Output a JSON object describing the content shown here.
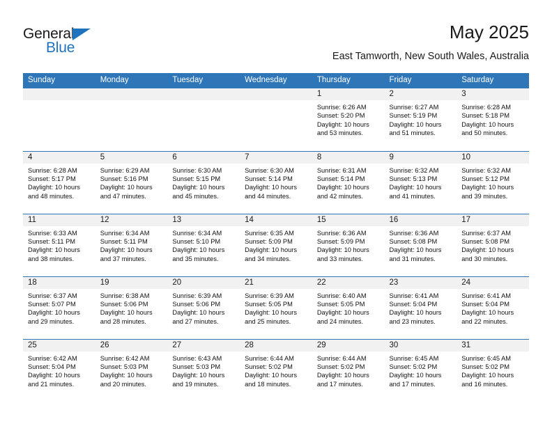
{
  "brand": {
    "name_part1": "General",
    "name_part2": "Blue",
    "triangle_color": "#1f72bd"
  },
  "header": {
    "title": "May 2025",
    "subtitle": "East Tamworth, New South Wales, Australia"
  },
  "theme": {
    "header_bar": "#2f76b8",
    "daynum_strip": "#f1f1f1",
    "row_divider": "#2f76b8",
    "text": "#1a1a1a"
  },
  "weekdays": [
    "Sunday",
    "Monday",
    "Tuesday",
    "Wednesday",
    "Thursday",
    "Friday",
    "Saturday"
  ],
  "weeks": [
    [
      {
        "day": ""
      },
      {
        "day": ""
      },
      {
        "day": ""
      },
      {
        "day": ""
      },
      {
        "day": "1",
        "sunrise": "Sunrise: 6:26 AM",
        "sunset": "Sunset: 5:20 PM",
        "daylight_l1": "Daylight: 10 hours",
        "daylight_l2": "and 53 minutes."
      },
      {
        "day": "2",
        "sunrise": "Sunrise: 6:27 AM",
        "sunset": "Sunset: 5:19 PM",
        "daylight_l1": "Daylight: 10 hours",
        "daylight_l2": "and 51 minutes."
      },
      {
        "day": "3",
        "sunrise": "Sunrise: 6:28 AM",
        "sunset": "Sunset: 5:18 PM",
        "daylight_l1": "Daylight: 10 hours",
        "daylight_l2": "and 50 minutes."
      }
    ],
    [
      {
        "day": "4",
        "sunrise": "Sunrise: 6:28 AM",
        "sunset": "Sunset: 5:17 PM",
        "daylight_l1": "Daylight: 10 hours",
        "daylight_l2": "and 48 minutes."
      },
      {
        "day": "5",
        "sunrise": "Sunrise: 6:29 AM",
        "sunset": "Sunset: 5:16 PM",
        "daylight_l1": "Daylight: 10 hours",
        "daylight_l2": "and 47 minutes."
      },
      {
        "day": "6",
        "sunrise": "Sunrise: 6:30 AM",
        "sunset": "Sunset: 5:15 PM",
        "daylight_l1": "Daylight: 10 hours",
        "daylight_l2": "and 45 minutes."
      },
      {
        "day": "7",
        "sunrise": "Sunrise: 6:30 AM",
        "sunset": "Sunset: 5:14 PM",
        "daylight_l1": "Daylight: 10 hours",
        "daylight_l2": "and 44 minutes."
      },
      {
        "day": "8",
        "sunrise": "Sunrise: 6:31 AM",
        "sunset": "Sunset: 5:14 PM",
        "daylight_l1": "Daylight: 10 hours",
        "daylight_l2": "and 42 minutes."
      },
      {
        "day": "9",
        "sunrise": "Sunrise: 6:32 AM",
        "sunset": "Sunset: 5:13 PM",
        "daylight_l1": "Daylight: 10 hours",
        "daylight_l2": "and 41 minutes."
      },
      {
        "day": "10",
        "sunrise": "Sunrise: 6:32 AM",
        "sunset": "Sunset: 5:12 PM",
        "daylight_l1": "Daylight: 10 hours",
        "daylight_l2": "and 39 minutes."
      }
    ],
    [
      {
        "day": "11",
        "sunrise": "Sunrise: 6:33 AM",
        "sunset": "Sunset: 5:11 PM",
        "daylight_l1": "Daylight: 10 hours",
        "daylight_l2": "and 38 minutes."
      },
      {
        "day": "12",
        "sunrise": "Sunrise: 6:34 AM",
        "sunset": "Sunset: 5:11 PM",
        "daylight_l1": "Daylight: 10 hours",
        "daylight_l2": "and 37 minutes."
      },
      {
        "day": "13",
        "sunrise": "Sunrise: 6:34 AM",
        "sunset": "Sunset: 5:10 PM",
        "daylight_l1": "Daylight: 10 hours",
        "daylight_l2": "and 35 minutes."
      },
      {
        "day": "14",
        "sunrise": "Sunrise: 6:35 AM",
        "sunset": "Sunset: 5:09 PM",
        "daylight_l1": "Daylight: 10 hours",
        "daylight_l2": "and 34 minutes."
      },
      {
        "day": "15",
        "sunrise": "Sunrise: 6:36 AM",
        "sunset": "Sunset: 5:09 PM",
        "daylight_l1": "Daylight: 10 hours",
        "daylight_l2": "and 33 minutes."
      },
      {
        "day": "16",
        "sunrise": "Sunrise: 6:36 AM",
        "sunset": "Sunset: 5:08 PM",
        "daylight_l1": "Daylight: 10 hours",
        "daylight_l2": "and 31 minutes."
      },
      {
        "day": "17",
        "sunrise": "Sunrise: 6:37 AM",
        "sunset": "Sunset: 5:08 PM",
        "daylight_l1": "Daylight: 10 hours",
        "daylight_l2": "and 30 minutes."
      }
    ],
    [
      {
        "day": "18",
        "sunrise": "Sunrise: 6:37 AM",
        "sunset": "Sunset: 5:07 PM",
        "daylight_l1": "Daylight: 10 hours",
        "daylight_l2": "and 29 minutes."
      },
      {
        "day": "19",
        "sunrise": "Sunrise: 6:38 AM",
        "sunset": "Sunset: 5:06 PM",
        "daylight_l1": "Daylight: 10 hours",
        "daylight_l2": "and 28 minutes."
      },
      {
        "day": "20",
        "sunrise": "Sunrise: 6:39 AM",
        "sunset": "Sunset: 5:06 PM",
        "daylight_l1": "Daylight: 10 hours",
        "daylight_l2": "and 27 minutes."
      },
      {
        "day": "21",
        "sunrise": "Sunrise: 6:39 AM",
        "sunset": "Sunset: 5:05 PM",
        "daylight_l1": "Daylight: 10 hours",
        "daylight_l2": "and 25 minutes."
      },
      {
        "day": "22",
        "sunrise": "Sunrise: 6:40 AM",
        "sunset": "Sunset: 5:05 PM",
        "daylight_l1": "Daylight: 10 hours",
        "daylight_l2": "and 24 minutes."
      },
      {
        "day": "23",
        "sunrise": "Sunrise: 6:41 AM",
        "sunset": "Sunset: 5:04 PM",
        "daylight_l1": "Daylight: 10 hours",
        "daylight_l2": "and 23 minutes."
      },
      {
        "day": "24",
        "sunrise": "Sunrise: 6:41 AM",
        "sunset": "Sunset: 5:04 PM",
        "daylight_l1": "Daylight: 10 hours",
        "daylight_l2": "and 22 minutes."
      }
    ],
    [
      {
        "day": "25",
        "sunrise": "Sunrise: 6:42 AM",
        "sunset": "Sunset: 5:04 PM",
        "daylight_l1": "Daylight: 10 hours",
        "daylight_l2": "and 21 minutes."
      },
      {
        "day": "26",
        "sunrise": "Sunrise: 6:42 AM",
        "sunset": "Sunset: 5:03 PM",
        "daylight_l1": "Daylight: 10 hours",
        "daylight_l2": "and 20 minutes."
      },
      {
        "day": "27",
        "sunrise": "Sunrise: 6:43 AM",
        "sunset": "Sunset: 5:03 PM",
        "daylight_l1": "Daylight: 10 hours",
        "daylight_l2": "and 19 minutes."
      },
      {
        "day": "28",
        "sunrise": "Sunrise: 6:44 AM",
        "sunset": "Sunset: 5:02 PM",
        "daylight_l1": "Daylight: 10 hours",
        "daylight_l2": "and 18 minutes."
      },
      {
        "day": "29",
        "sunrise": "Sunrise: 6:44 AM",
        "sunset": "Sunset: 5:02 PM",
        "daylight_l1": "Daylight: 10 hours",
        "daylight_l2": "and 17 minutes."
      },
      {
        "day": "30",
        "sunrise": "Sunrise: 6:45 AM",
        "sunset": "Sunset: 5:02 PM",
        "daylight_l1": "Daylight: 10 hours",
        "daylight_l2": "and 17 minutes."
      },
      {
        "day": "31",
        "sunrise": "Sunrise: 6:45 AM",
        "sunset": "Sunset: 5:02 PM",
        "daylight_l1": "Daylight: 10 hours",
        "daylight_l2": "and 16 minutes."
      }
    ]
  ]
}
